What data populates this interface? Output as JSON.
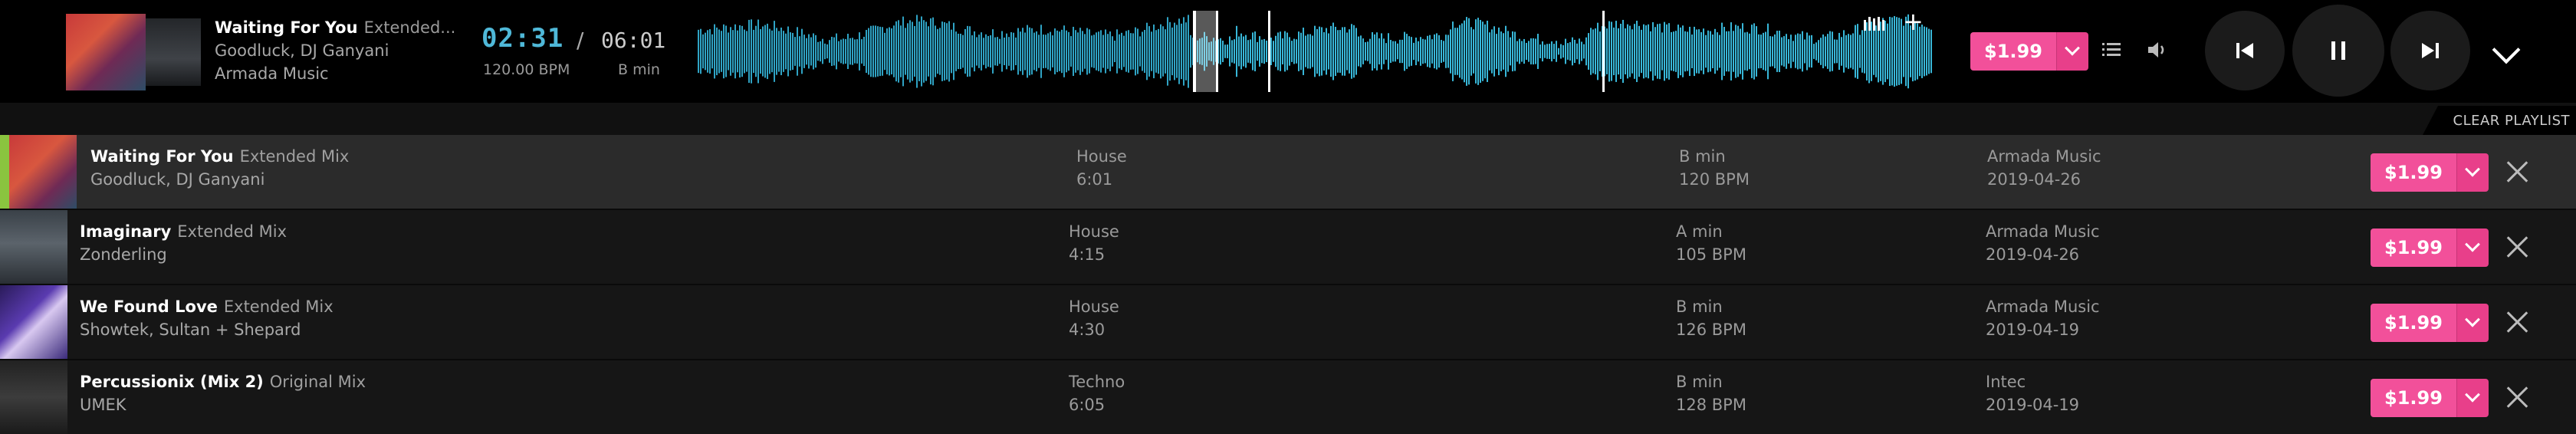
{
  "now_playing": {
    "title": "Waiting For You",
    "mix": "Extended...",
    "artists": "Goodluck, DJ Ganyani",
    "label": "Armada Music",
    "current_time": "02:31",
    "separator": "/",
    "duration": "06:01",
    "bpm": "120.00 BPM",
    "key": "B min",
    "price": "$1.99"
  },
  "colors": {
    "accent": "#4fb8d8",
    "price": "#f2509a",
    "active_marker": "#8ac43f"
  },
  "controls": {
    "clear_playlist": "CLEAR PLAYLIST"
  },
  "playlist": [
    {
      "title": "Waiting For You",
      "mix": "Extended Mix",
      "artists": "Goodluck, DJ Ganyani",
      "genre": "House",
      "length": "6:01",
      "key": "B min",
      "bpm": "120 BPM",
      "label": "Armada Music",
      "date": "2019-04-26",
      "price": "$1.99"
    },
    {
      "title": "Imaginary",
      "mix": "Extended Mix",
      "artists": "Zonderling",
      "genre": "House",
      "length": "4:15",
      "key": "A min",
      "bpm": "105 BPM",
      "label": "Armada Music",
      "date": "2019-04-26",
      "price": "$1.99"
    },
    {
      "title": "We Found Love",
      "mix": "Extended Mix",
      "artists": "Showtek, Sultan + Shepard",
      "genre": "House",
      "length": "4:30",
      "key": "B min",
      "bpm": "126 BPM",
      "label": "Armada Music",
      "date": "2019-04-19",
      "price": "$1.99"
    },
    {
      "title": "Percussionix (Mix 2)",
      "mix": "Original Mix",
      "artists": "UMEK",
      "genre": "Techno",
      "length": "6:05",
      "key": "B min",
      "bpm": "128 BPM",
      "label": "Intec",
      "date": "2019-04-19",
      "price": "$1.99"
    }
  ]
}
